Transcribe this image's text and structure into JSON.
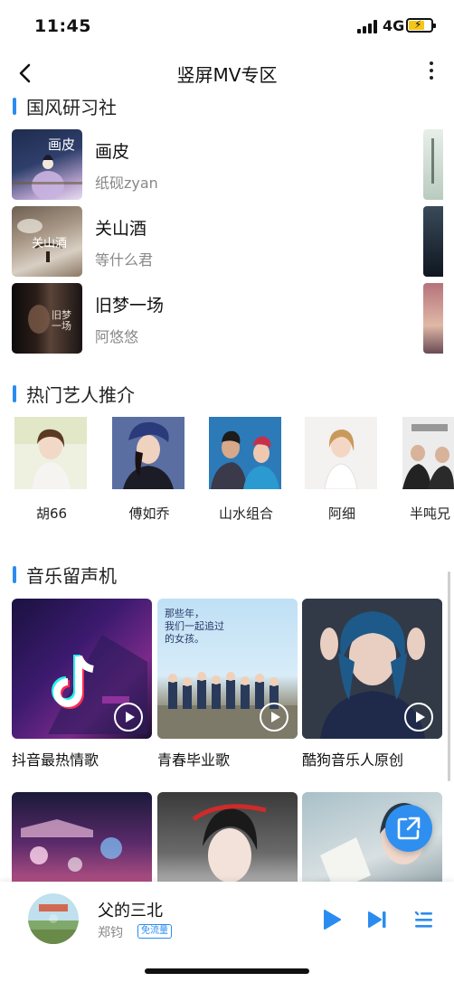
{
  "status": {
    "time": "11:45",
    "network": "4G"
  },
  "header": {
    "title": "竖屏MV专区"
  },
  "sections": {
    "guofeng": "国风研习社",
    "artists": "热门艺人推介",
    "jukebox": "音乐留声机"
  },
  "guofeng_items": [
    {
      "title": "画皮",
      "artist": "纸砚zyan",
      "cover_text": "画皮"
    },
    {
      "title": "关山酒",
      "artist": "等什么君",
      "cover_text": "关山酒"
    },
    {
      "title": "旧梦一场",
      "artist": "阿悠悠",
      "cover_text": "旧梦一场"
    }
  ],
  "artists": [
    {
      "name": "胡66"
    },
    {
      "name": "傅如乔"
    },
    {
      "name": "山水组合"
    },
    {
      "name": "阿细"
    },
    {
      "name": "半吨兄"
    }
  ],
  "playlists": [
    {
      "title": "抖音最热情歌"
    },
    {
      "title": "青春毕业歌",
      "cover_text_1": "那些年，",
      "cover_text_2": "我们一起追过",
      "cover_text_3": "的女孩。"
    },
    {
      "title": "酷狗音乐人原创"
    }
  ],
  "player": {
    "title": "父的三北",
    "artist": "郑钧",
    "badge": "免流量"
  },
  "colors": {
    "accent": "#2a8cf0"
  },
  "icons": [
    "back-arrow-icon",
    "more-vertical-icon",
    "play-circle-icon",
    "share-icon",
    "play-icon",
    "next-icon",
    "playlist-icon"
  ]
}
